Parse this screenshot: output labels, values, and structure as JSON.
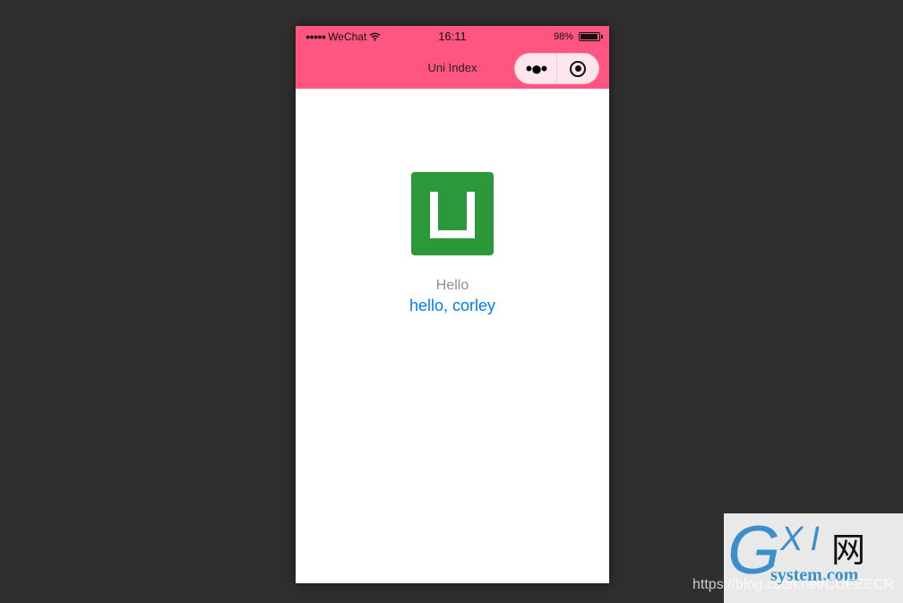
{
  "status_bar": {
    "signal": "●●●●●",
    "carrier": "WeChat",
    "time": "16:11",
    "battery": "98%",
    "battery_level": 0.98
  },
  "nav": {
    "title": "Uni Index",
    "menu_icon": "more-dots-icon",
    "close_icon": "record-circle-icon"
  },
  "content": {
    "logo": "uni-app-logo",
    "title": "Hello",
    "message": "hello, corley"
  },
  "colors": {
    "nav": "#ff5580",
    "logo": "#2b9939",
    "message": "#007aff"
  },
  "watermark": {
    "logo_text": "GXI网 system.com",
    "url": "https://blog.csdn.net/CUFEECR"
  }
}
